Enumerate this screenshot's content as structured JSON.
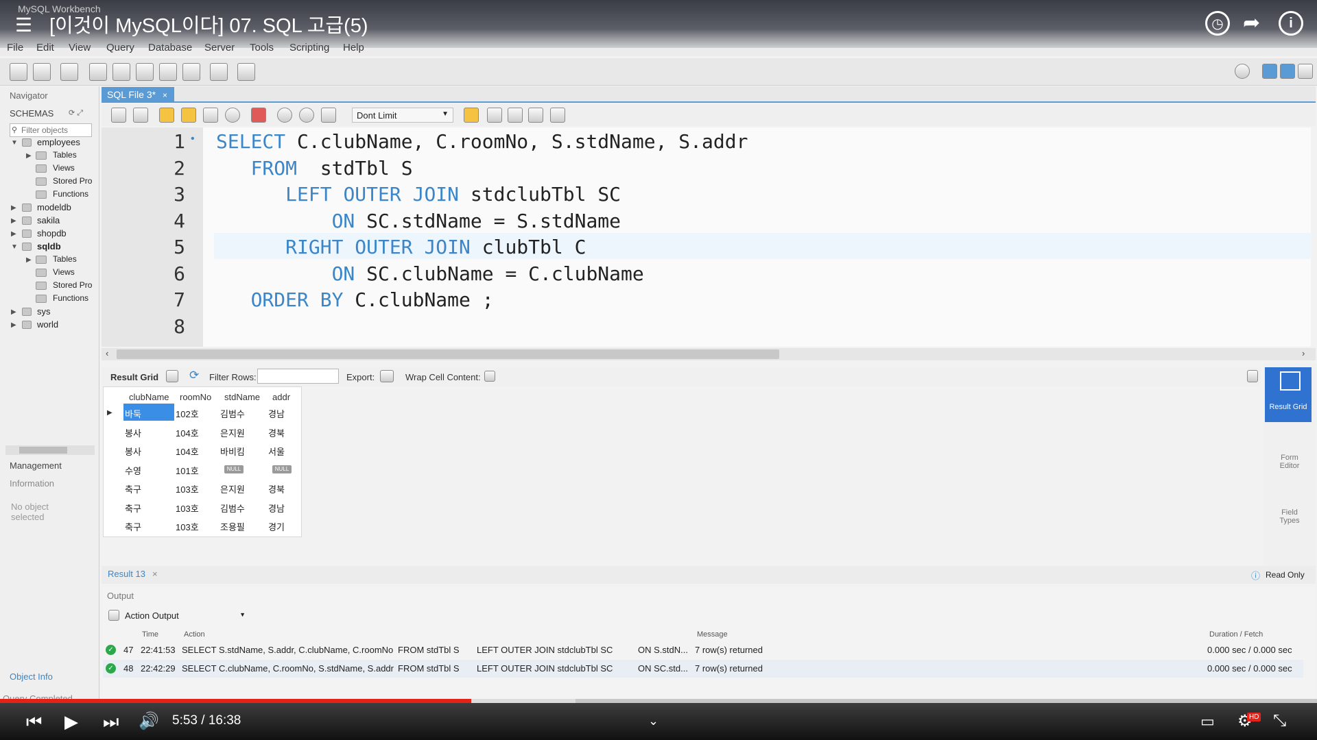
{
  "video": {
    "title": "[이것이 MySQL이다] 07. SQL 고급(5)",
    "time_current": "5:53",
    "time_separator": "/",
    "time_total": "16:38",
    "progress": 0.358,
    "buffered": 0.437
  },
  "app": {
    "title": "MySQL Workbench"
  },
  "menu": [
    "File",
    "Edit",
    "View",
    "Query",
    "Database",
    "Server",
    "Tools",
    "Scripting",
    "Help"
  ],
  "navigator": {
    "header": "Navigator",
    "schemas_label": "SCHEMAS",
    "filter_placeholder": "Filter objects",
    "tree": [
      {
        "label": "employees",
        "bold": false,
        "expanded": true,
        "children": [
          "Tables",
          "Views",
          "Stored Pro",
          "Functions"
        ]
      },
      {
        "label": "modeldb",
        "bold": false,
        "expanded": false,
        "children": []
      },
      {
        "label": "sakila",
        "bold": false,
        "expanded": false,
        "children": []
      },
      {
        "label": "shopdb",
        "bold": false,
        "expanded": false,
        "children": []
      },
      {
        "label": "sqldb",
        "bold": true,
        "expanded": true,
        "children": [
          "Tables",
          "Views",
          "Stored Pro",
          "Functions"
        ]
      },
      {
        "label": "sys",
        "bold": false,
        "expanded": false,
        "children": []
      },
      {
        "label": "world",
        "bold": false,
        "expanded": false,
        "children": []
      }
    ],
    "management_tab": "Management",
    "information_label": "Information",
    "no_object": "No object selected",
    "object_info_tab": "Object Info",
    "status": "Query Completed"
  },
  "editor": {
    "tab_label": "SQL File 3*",
    "limit_value": "Dont Limit",
    "lines": [
      {
        "num": "1",
        "indent": "",
        "kw": "SELECT",
        "rest": " C.clubName, C.roomNo, S.stdName, S.addr"
      },
      {
        "num": "2",
        "indent": "   ",
        "kw": "FROM",
        "rest": "  stdTbl S"
      },
      {
        "num": "3",
        "indent": "      ",
        "kw": "LEFT OUTER JOIN",
        "rest": " stdclubTbl SC"
      },
      {
        "num": "4",
        "indent": "          ",
        "kw": "ON",
        "rest": " SC.stdName = S.stdName"
      },
      {
        "num": "5",
        "indent": "      ",
        "kw": "RIGHT OUTER JOIN",
        "rest": " clubTbl C"
      },
      {
        "num": "6",
        "indent": "          ",
        "kw": "ON",
        "rest": " SC.clubName = C.clubName"
      },
      {
        "num": "7",
        "indent": "   ",
        "kw": "ORDER BY",
        "rest": " C.clubName ;"
      },
      {
        "num": "8",
        "indent": "",
        "kw": "",
        "rest": ""
      }
    ],
    "line1_marker": "•"
  },
  "result": {
    "grid_label": "Result Grid",
    "filter_label": "Filter Rows:",
    "export_label": "Export:",
    "wrap_label": "Wrap Cell Content:",
    "columns": [
      "clubName",
      "roomNo",
      "stdName",
      "addr"
    ],
    "rows": [
      [
        "바둑",
        "102호",
        "김범수",
        "경남"
      ],
      [
        "봉사",
        "104호",
        "은지원",
        "경북"
      ],
      [
        "봉사",
        "104호",
        "바비킴",
        "서울"
      ],
      [
        "수영",
        "101호",
        "NULL",
        "NULL"
      ],
      [
        "축구",
        "103호",
        "은지원",
        "경북"
      ],
      [
        "축구",
        "103호",
        "김범수",
        "경남"
      ],
      [
        "축구",
        "103호",
        "조용필",
        "경기"
      ]
    ],
    "tab_label": "Result 13",
    "read_only": "Read Only",
    "rail": {
      "result_grid": "Result Grid",
      "form_editor": "Form Editor",
      "field_types": "Field Types"
    }
  },
  "output": {
    "header": "Output",
    "selector": "Action Output",
    "columns": {
      "time": "Time",
      "action": "Action",
      "message": "Message",
      "duration": "Duration / Fetch"
    },
    "rows": [
      {
        "num": "47",
        "time": "22:41:53",
        "a1": "SELECT S.stdName, S.addr, C.clubName, C.roomNo",
        "a2": "FROM stdTbl S",
        "a3": "LEFT OUTER JOIN stdclubTbl SC",
        "a4": "ON S.stdN...",
        "message": "7 row(s) returned",
        "duration": "0.000 sec / 0.000 sec"
      },
      {
        "num": "48",
        "time": "22:42:29",
        "a1": "SELECT C.clubName, C.roomNo, S.stdName, S.addr",
        "a2": "FROM stdTbl S",
        "a3": "LEFT OUTER JOIN stdclubTbl SC",
        "a4": "ON SC.std...",
        "message": "7 row(s) returned",
        "duration": "0.000 sec / 0.000 sec"
      }
    ]
  },
  "colors": {
    "accent": "#5b9bd5",
    "keyword": "#3a86c8",
    "yt_red": "#e62117",
    "ok": "#2aa84a"
  }
}
